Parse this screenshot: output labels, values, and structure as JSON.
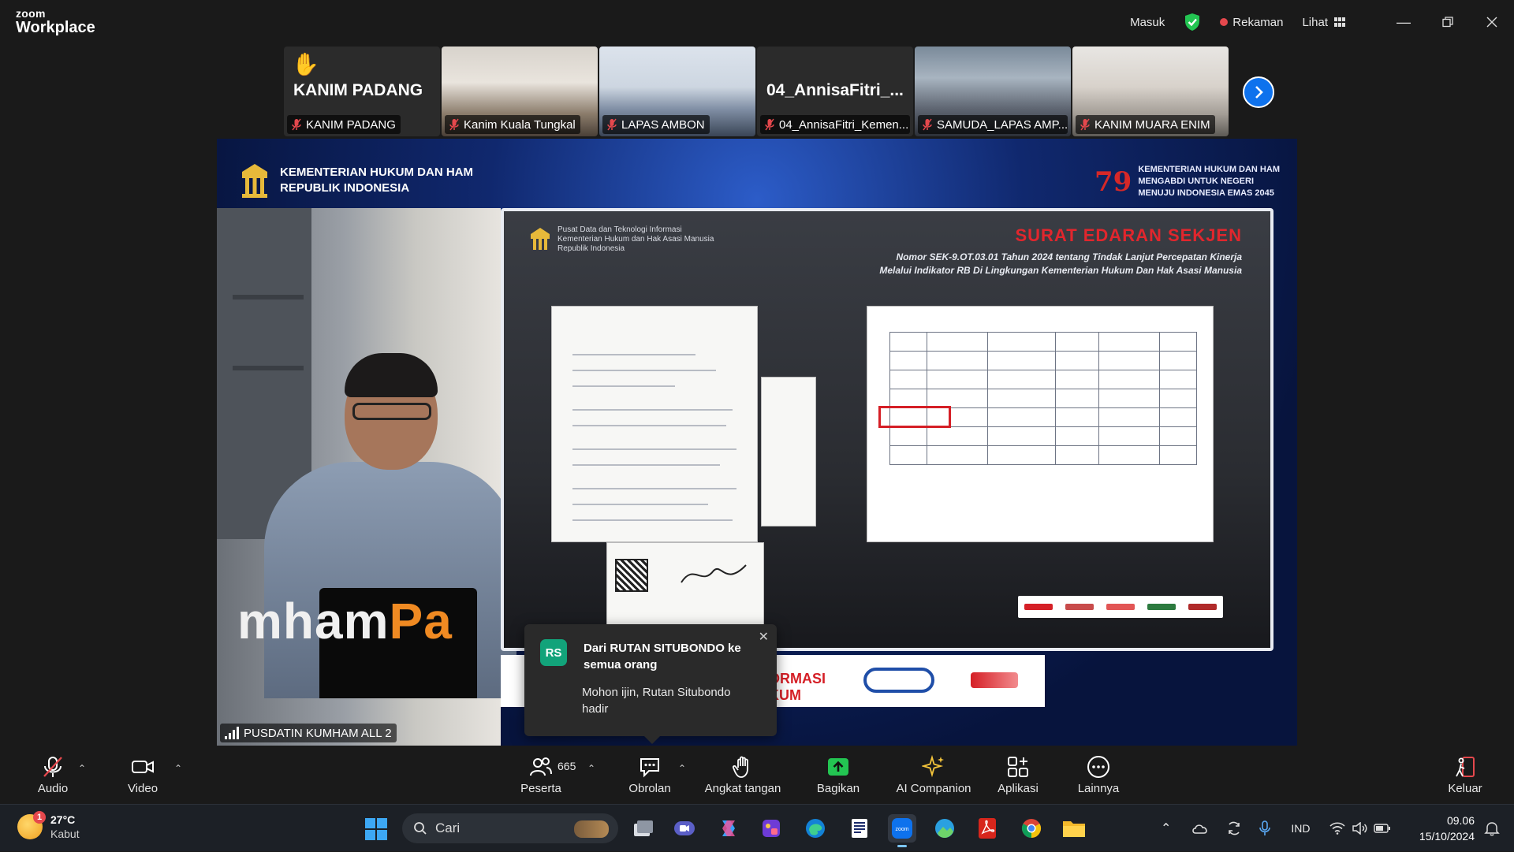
{
  "window": {
    "brand_top": "zoom",
    "brand_bottom": "Workplace",
    "masuk": "Masuk",
    "rekaman": "Rekaman",
    "lihat": "Lihat"
  },
  "thumbnails": [
    {
      "big_name": "KANIM PADANG",
      "label": "KANIM PADANG",
      "hand_raised": true
    },
    {
      "big_name": "",
      "label": "Kanim Kuala Tungkal",
      "hand_raised": false
    },
    {
      "big_name": "",
      "label": "LAPAS AMBON",
      "hand_raised": false
    },
    {
      "big_name": "04_AnnisaFitri_...",
      "label": "04_AnnisaFitri_Kemen...",
      "hand_raised": false
    },
    {
      "big_name": "",
      "label": "SAMUDA_LAPAS AMP...",
      "hand_raised": false
    },
    {
      "big_name": "",
      "label": "KANIM MUARA ENIM",
      "hand_raised": false
    }
  ],
  "main_video": {
    "org_line1": "KEMENTERIAN HUKUM DAN HAM",
    "org_line2": "REPUBLIK INDONESIA",
    "right_line1": "KEMENTERIAN HUKUM DAN HAM",
    "right_line2": "MENGABDI UNTUK NEGERI",
    "right_line3": "MENUJU INDONESIA EMAS 2045",
    "badge": "79",
    "pusdatin_line1": "Pusat Data dan Teknologi Informasi",
    "pusdatin_line2": "Kementerian Hukum dan Hak Asasi Manusia",
    "pusdatin_line3": "Republik Indonesia",
    "slide_title": "SURAT EDARAN SEKJEN",
    "slide_sub1": "Nomor SEK-9.OT.03.01 Tahun 2024 tentang Tindak Lanjut Percepatan Kinerja",
    "slide_sub2": "Melalui Indikator RB Di Lingkungan Kementerian Hukum Dan Hak Asasi Manusia",
    "background_word": "mham",
    "background_word_tail": "Pa",
    "bottom_banner_text": "ORMASI\nKUM",
    "active_speaker": "PUSDATIN KUMHAM ALL 2"
  },
  "chat_toast": {
    "avatar": "RS",
    "from": "Dari RUTAN SITUBONDO ke semua orang",
    "message": "Mohon ijin, Rutan Situbondo hadir"
  },
  "toolbar": {
    "audio": "Audio",
    "video": "Video",
    "participants": "Peserta",
    "participants_count": "665",
    "chat": "Obrolan",
    "raise_hand": "Angkat tangan",
    "share": "Bagikan",
    "ai_companion": "AI Companion",
    "apps": "Aplikasi",
    "more": "Lainnya",
    "leave": "Keluar"
  },
  "taskbar": {
    "temperature": "27°C",
    "weather": "Kabut",
    "weather_badge": "1",
    "search_placeholder": "Cari",
    "language": "IND",
    "time": "09.06",
    "date": "15/10/2024"
  },
  "colors": {
    "accent_blue": "#0e72ed",
    "recording_red": "#e5484d",
    "share_green": "#23c552",
    "leave_red": "#e5484d"
  }
}
